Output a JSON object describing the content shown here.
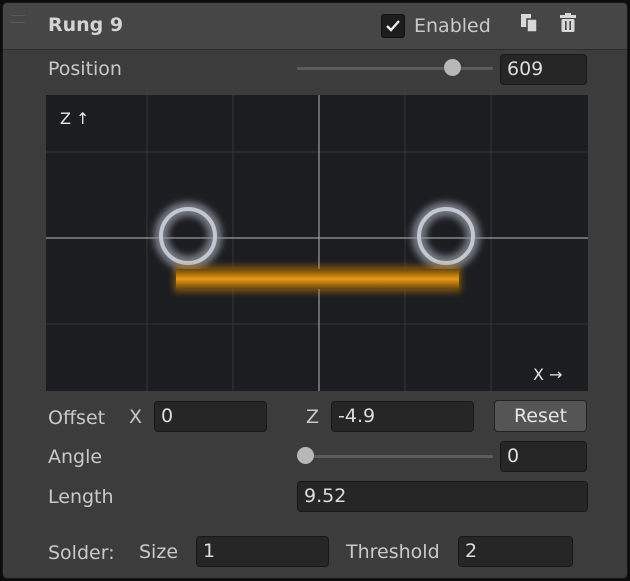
{
  "header": {
    "title": "Rung 9",
    "enabled_label": "Enabled",
    "enabled_checked": true,
    "icons": [
      "copy-icon",
      "trash-icon"
    ]
  },
  "position": {
    "label": "Position",
    "value": "609",
    "slider_fraction": 0.82
  },
  "viewport": {
    "z_axis_label": "Z ↑",
    "x_axis_label": "X →"
  },
  "offset": {
    "label": "Offset",
    "x_label": "X",
    "x_value": "0",
    "z_label": "Z",
    "z_value": "-4.9",
    "reset_label": "Reset"
  },
  "angle": {
    "label": "Angle",
    "value": "0",
    "slider_fraction": 0.0
  },
  "length": {
    "label": "Length",
    "value": "9.52"
  },
  "solder": {
    "label": "Solder:",
    "size_label": "Size",
    "size_value": "1",
    "threshold_label": "Threshold",
    "threshold_value": "2"
  },
  "colors": {
    "rung_bar": "#d08a12",
    "ring": "#b6bcc6",
    "panel_bg": "#3c3c3c"
  }
}
